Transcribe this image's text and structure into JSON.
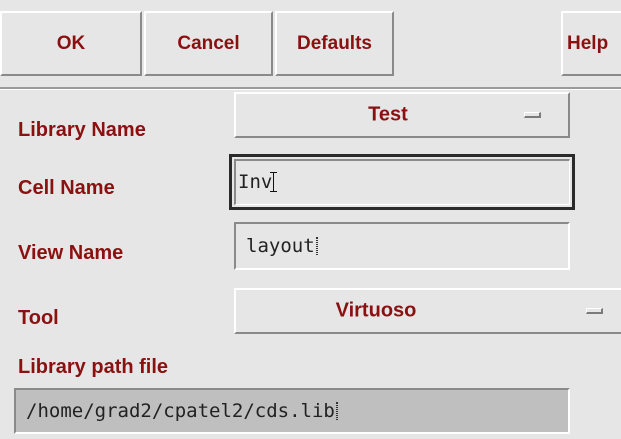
{
  "buttons": {
    "ok": "OK",
    "cancel": "Cancel",
    "defaults": "Defaults",
    "help": "Help"
  },
  "form": {
    "library_name": {
      "label": "Library Name",
      "value": "Test"
    },
    "cell_name": {
      "label": "Cell Name",
      "value": "Inv"
    },
    "view_name": {
      "label": "View Name",
      "value": "layout"
    },
    "tool": {
      "label": "Tool",
      "value": "Virtuoso"
    },
    "library_path_file": {
      "label": "Library path file",
      "value": "/home/grad2/cpatel2/cds.lib"
    }
  },
  "colors": {
    "label_text": "#8b1010",
    "background": "#e6e6e6",
    "readonly_field": "#bfbfbf"
  },
  "icons": {
    "cyclic_marker": "cyclic-field-marker-icon",
    "text_cursor": "ibeam-cursor-icon"
  }
}
